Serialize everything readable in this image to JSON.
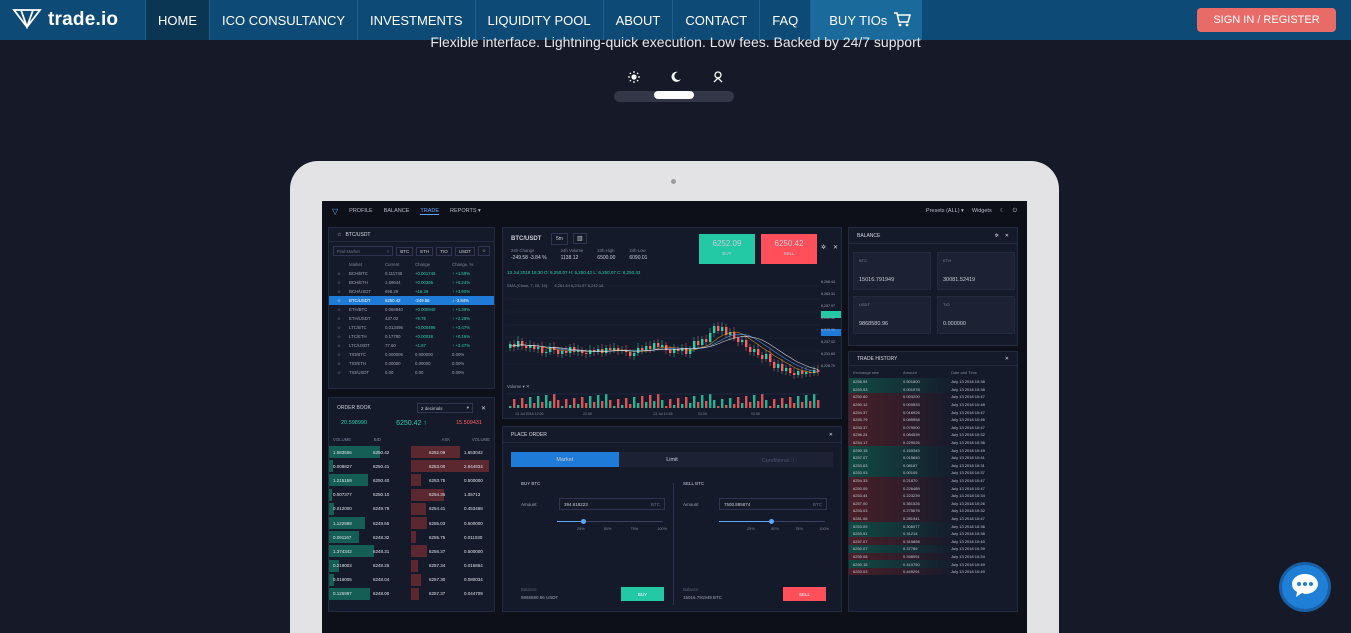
{
  "nav": {
    "logo_text": "trade.io",
    "items": [
      "HOME",
      "ICO CONSULTANCY",
      "INVESTMENTS",
      "LIQUIDITY POOL",
      "ABOUT",
      "CONTACT",
      "FAQ"
    ],
    "buy_label": "BUY TIOs",
    "signin_label": "SIGN IN / REGISTER"
  },
  "hero": {
    "tagline": "Flexible interface. Lightning-quick execution. Low fees. Backed by 24/7 support",
    "theme_icons": [
      "sun-icon",
      "moon-icon",
      "accessibility-icon"
    ]
  },
  "app": {
    "top_nav": [
      "PROFILE",
      "BALANCE",
      "TRADE",
      "REPORTS ▾"
    ],
    "top_right": [
      "Presets (ALL) ▾",
      "Widgets"
    ],
    "markets": {
      "title": "BTC/USDT",
      "search_placeholder": "Find Market",
      "filters": [
        "BTC",
        "ETH",
        "TIO",
        "USDT"
      ],
      "headers": [
        "Market",
        "Current",
        "Change",
        "Change, %"
      ],
      "rows": [
        [
          "BCH/BTC",
          "0.111745",
          "+0.001745",
          "↑ +1.59%"
        ],
        [
          "BCH/ETH",
          "1.59644",
          "+0.00365",
          "↑ +0.24%"
        ],
        [
          "BCH/USDT",
          "698.29",
          "+18.29",
          "↑ +3.90%"
        ],
        [
          "BTC/USDT",
          "6250.42",
          "-249.58",
          "↓ -3.84%"
        ],
        [
          "ETH/BTC",
          "0.069940",
          "+0.000940",
          "↑ +1.39%"
        ],
        [
          "ETH/USDT",
          "437.02",
          "+9.76",
          "↑ +2.29%"
        ],
        [
          "LTC/BTC",
          "0.013496",
          "+0.000496",
          "↑ +3.47%"
        ],
        [
          "LTC/ETH",
          "0.17780",
          "+0.00028",
          "↑ +0.16%"
        ],
        [
          "LTC/USDT",
          "77.60",
          "+1.87",
          "↑ +3.47%"
        ],
        [
          "TIO/BTC",
          "0.000006",
          "0.000000",
          "0.00%"
        ],
        [
          "TIO/ETH",
          "0.00000",
          "0.00000",
          "0.00%"
        ],
        [
          "TIO/USDT",
          "0.00",
          "0.00",
          "0.00%"
        ]
      ]
    },
    "orderbook": {
      "title": "ORDER BOOK",
      "decimals": "2 decimals",
      "left_val": "20.598990",
      "mid_price": "6250.42 ↑",
      "right_val": "15.509431",
      "headers": [
        "VOLUME",
        "BID",
        "ASK",
        "VOLUME"
      ],
      "rows": [
        [
          "1.583556",
          "6250.42",
          "6252.09",
          "1.653042"
        ],
        [
          "0.008827",
          "6250.41",
          "6253.00",
          "2.844834"
        ],
        [
          "1.215159",
          "6250.40",
          "6253.75",
          "0.500000"
        ],
        [
          "0.007377",
          "6250.10",
          "6254.36",
          "1.05713"
        ],
        [
          "0.012000",
          "6249.79",
          "6254.41",
          "0.453468"
        ],
        [
          "1.122988",
          "6249.55",
          "6255.03",
          "0.500000"
        ],
        [
          "0.091167",
          "6248.32",
          "6255.75",
          "0.011030"
        ],
        [
          "1.374342",
          "6248.31",
          "6256.37",
          "0.500000"
        ],
        [
          "0.219003",
          "6248.26",
          "6257.34",
          "0.016864"
        ],
        [
          "0.016005",
          "6248.04",
          "6257.30",
          "0.080034"
        ],
        [
          "0.125987",
          "6248.00",
          "6257.37",
          "0.044709"
        ]
      ]
    },
    "ticker": {
      "pair": "BTC/USDT",
      "interval": "5m",
      "stats": [
        {
          "label": "24h Change",
          "value": "-249.58 -3.84 %"
        },
        {
          "label": "24h Volume",
          "value": "1138.12"
        },
        {
          "label": "24h High",
          "value": "6500.00"
        },
        {
          "label": "24h Low",
          "value": "6090.01"
        }
      ],
      "buy_price": "6252.09",
      "buy_label": "BUY",
      "sell_price": "6250.42",
      "sell_label": "SELL",
      "ohlc": "13 Jul 2018 16:30   O: 6,250.07   H: 6,250.42   L: 6,250.07   C: 6,250.42",
      "sma": "SMA (Close, 7, 15, 10)",
      "sma_values": "6,264.64   6,241.97   6,242.18",
      "volume_label": "Volume",
      "price_axis": [
        "6,268.44",
        "6,263.31",
        "6,257.97",
        "6,250.42",
        "6,243.30",
        "6,237.02",
        "6,231.60",
        "6,225.70"
      ],
      "time_axis": [
        "13 Jul 2018 12:00",
        "22:00",
        "13 Jul 10:45",
        "01:00",
        "02:00"
      ]
    },
    "place_order": {
      "title": "PLACE ORDER",
      "tabs": [
        "Market",
        "Limit",
        "Conditional ⓘ"
      ],
      "buy": {
        "title": "BUY BTC",
        "amount_label": "Amount",
        "amount": "394.618223",
        "unit": "BTC",
        "balance_label": "Balance",
        "balance": "9868580.96 USDT",
        "button": "BUY"
      },
      "sell": {
        "title": "SELL BTC",
        "amount_label": "Amount",
        "amount": "7500.885874",
        "unit": "BTC",
        "balance_label": "Balance",
        "balance": "15016.791949 BTC",
        "button": "SELL"
      },
      "pcts": [
        "25%",
        "50%",
        "75%",
        "100%"
      ]
    },
    "balance": {
      "title": "BALANCE",
      "cards": [
        {
          "currency": "BTC",
          "amount": "15016.791949"
        },
        {
          "currency": "ETH",
          "amount": "30081.52419"
        },
        {
          "currency": "USDT",
          "amount": "9868580.96"
        },
        {
          "currency": "TIO",
          "amount": "0.000000"
        }
      ]
    },
    "trade_history": {
      "title": "TRADE HISTORY",
      "headers": [
        "Exchange rate",
        "Amount",
        "Date and Time"
      ],
      "rows": [
        [
          "6256.94",
          "0.501800",
          "July 13 2018 10:38",
          "g"
        ],
        [
          "6253.93",
          "0.001978",
          "July 13 2018 10:38",
          "g"
        ],
        [
          "6250.80",
          "0.003200",
          "July 13 2018 10:47",
          "r"
        ],
        [
          "6250.12",
          "0.000533",
          "July 13 2018 10:48",
          "r"
        ],
        [
          "6254.37",
          "0.016926",
          "July 13 2018 10:47",
          "r"
        ],
        [
          "6255.79",
          "0.085958",
          "July 13 2018 10:46",
          "r"
        ],
        [
          "6253.37",
          "0.079000",
          "July 13 2018 10:47",
          "r"
        ],
        [
          "6256.24",
          "0.084539",
          "July 13 2018 10:32",
          "r"
        ],
        [
          "6254.17",
          "0.229026",
          "July 13 2018 10:36",
          "r"
        ],
        [
          "6250.15",
          "0.165345",
          "July 13 2018 10:49",
          "g"
        ],
        [
          "6257.07",
          "0.015840",
          "July 13 2018 10:41",
          "g"
        ],
        [
          "6253.63",
          "0.08187",
          "July 13 2018 10:31",
          "g"
        ],
        [
          "6253.93",
          "0.00105",
          "July 13 2018 10:37",
          "g"
        ],
        [
          "6254.33",
          "0.21870",
          "July 13 2018 10:47",
          "r"
        ],
        [
          "6250.09",
          "0.226489",
          "July 13 2018 10:47",
          "r"
        ],
        [
          "6253.44",
          "0.223239",
          "July 13 2018 10:34",
          "r"
        ],
        [
          "6257.00",
          "0.351526",
          "July 13 2018 10:26",
          "r"
        ],
        [
          "6253.03",
          "0.275676",
          "July 13 2018 10:32",
          "r"
        ],
        [
          "6281.06",
          "0.281941",
          "July 13 2018 10:47",
          "r"
        ],
        [
          "6253.09",
          "0.306977",
          "July 13 2018 10:36",
          "g"
        ],
        [
          "6253.91",
          "0.31214",
          "July 13 2018 10:38",
          "g"
        ],
        [
          "6257.07",
          "0.315898",
          "July 13 2018 10:40",
          "r"
        ],
        [
          "6250.07",
          "0.37789",
          "July 13 2018 10:39",
          "g"
        ],
        [
          "6255.08",
          "0.398991",
          "July 13 2018 10:34",
          "r"
        ],
        [
          "6250.15",
          "0.410750",
          "July 13 2018 10:49",
          "g"
        ],
        [
          "6253.03",
          "0.449291",
          "July 13 2018 10:49",
          "r"
        ]
      ]
    }
  },
  "colors": {
    "nav_bg": "#0d4a75",
    "accent_red": "#e96b67",
    "up": "#23d2a5",
    "down": "#ff5f5f",
    "page_bg": "#161a28"
  }
}
